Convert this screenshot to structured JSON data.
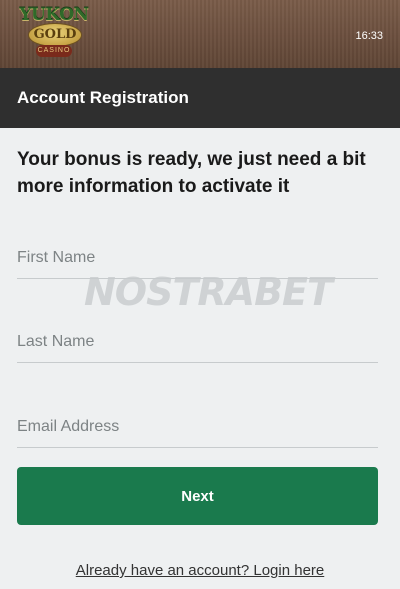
{
  "brand": {
    "logo_top": "YUKON",
    "logo_middle": "GOLD",
    "logo_bottom": "CASINO"
  },
  "status": {
    "time": "16:33"
  },
  "header": {
    "title": "Account Registration"
  },
  "intro": "Your bonus is ready, we just need a bit more information to activate it",
  "form": {
    "first_name_placeholder": "First Name",
    "last_name_placeholder": "Last Name",
    "email_placeholder": "Email Address",
    "next_label": "Next"
  },
  "login_link": "Already have an account? Login here",
  "watermark": "NOSTRABET",
  "colors": {
    "accent": "#1a7a4d",
    "header_bg": "#2f2f2f",
    "topbar_bg": "#6b4f3e"
  }
}
